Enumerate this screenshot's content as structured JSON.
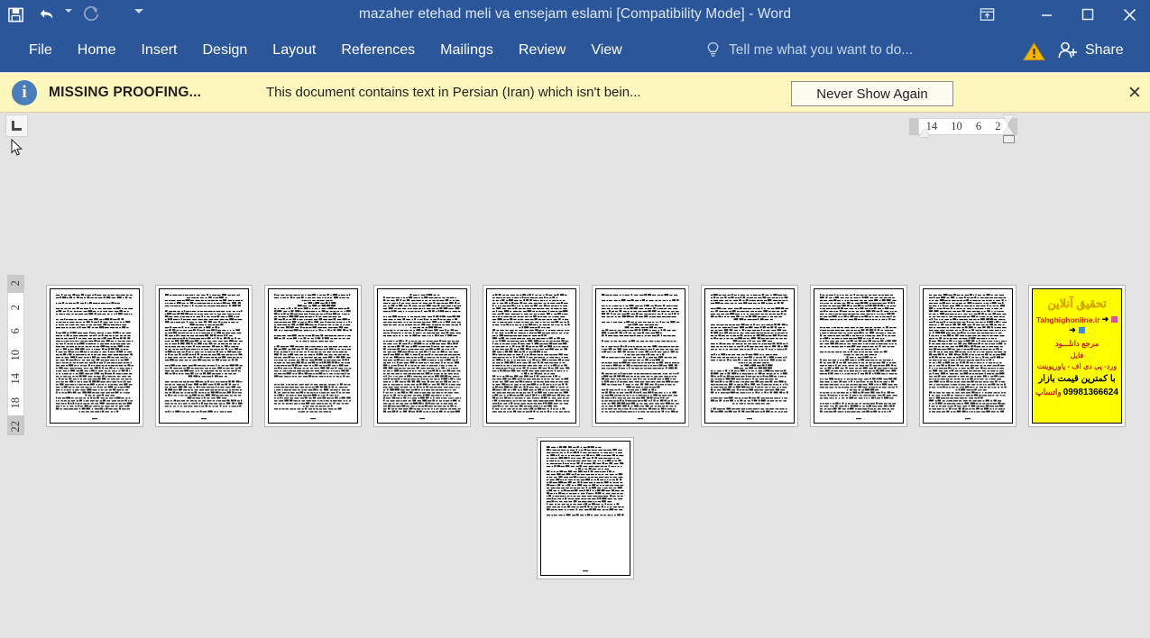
{
  "window": {
    "title": "mazaher etehad meli va ensejam eslami [Compatibility Mode] - Word",
    "quick_access": [
      {
        "name": "save-icon",
        "label": "Save"
      },
      {
        "name": "undo-icon",
        "label": "Undo"
      },
      {
        "name": "undo-dropdown-caret",
        "label": "Undo options"
      },
      {
        "name": "redo-icon",
        "label": "Redo"
      },
      {
        "name": "customize-qat-caret",
        "label": "Customize Quick Access Toolbar"
      }
    ],
    "controls": [
      {
        "name": "ribbon-display-options-icon",
        "label": "Ribbon Display Options"
      },
      {
        "name": "minimize-icon",
        "label": "Minimize"
      },
      {
        "name": "restore-icon",
        "label": "Restore Down"
      },
      {
        "name": "close-icon",
        "label": "Close"
      }
    ],
    "accent_color": "#2b579a"
  },
  "ribbon": {
    "tabs": [
      {
        "label": "File"
      },
      {
        "label": "Home"
      },
      {
        "label": "Insert"
      },
      {
        "label": "Design"
      },
      {
        "label": "Layout"
      },
      {
        "label": "References"
      },
      {
        "label": "Mailings"
      },
      {
        "label": "Review"
      },
      {
        "label": "View"
      }
    ],
    "tell_me_placeholder": "Tell me what you want to do...",
    "warning_label": "!",
    "share_label": "Share"
  },
  "message_bar": {
    "title": "MISSING PROOFING...",
    "body": "This document contains text in Persian (Iran) which isn't bein...",
    "button_label": "Never Show Again",
    "close_label": "✕",
    "background_color": "#fdf7bd"
  },
  "rulers": {
    "tab_selector_glyph": "L",
    "horizontal_ticks": [
      "14",
      "10",
      "6",
      "2"
    ],
    "vertical_ticks": [
      "2",
      "2",
      "6",
      "10",
      "14",
      "18",
      "22"
    ]
  },
  "document": {
    "page_count": 11,
    "pages": [
      {
        "index": 1,
        "type": "text"
      },
      {
        "index": 2,
        "type": "text"
      },
      {
        "index": 3,
        "type": "text"
      },
      {
        "index": 4,
        "type": "text"
      },
      {
        "index": 5,
        "type": "text"
      },
      {
        "index": 6,
        "type": "text"
      },
      {
        "index": 7,
        "type": "text"
      },
      {
        "index": 8,
        "type": "text"
      },
      {
        "index": 9,
        "type": "text"
      },
      {
        "index": 10,
        "type": "advertisement"
      },
      {
        "index": 11,
        "type": "text-partial"
      }
    ],
    "advertisement_page": {
      "headline": "تحقیق آنلاین",
      "site": "Tahghighonline.ir",
      "line3": "مرجع دانلـــود",
      "line4": "فایل",
      "line5": "ورد- پی دی اف - پاورپوینت",
      "line6": "با کمترین قیمت بازار",
      "whatsapp_label": "واتساپ",
      "phone": "09981366624",
      "background_color": "#ffff00"
    }
  },
  "canvas": {
    "background_color": "#e4e4e4"
  }
}
